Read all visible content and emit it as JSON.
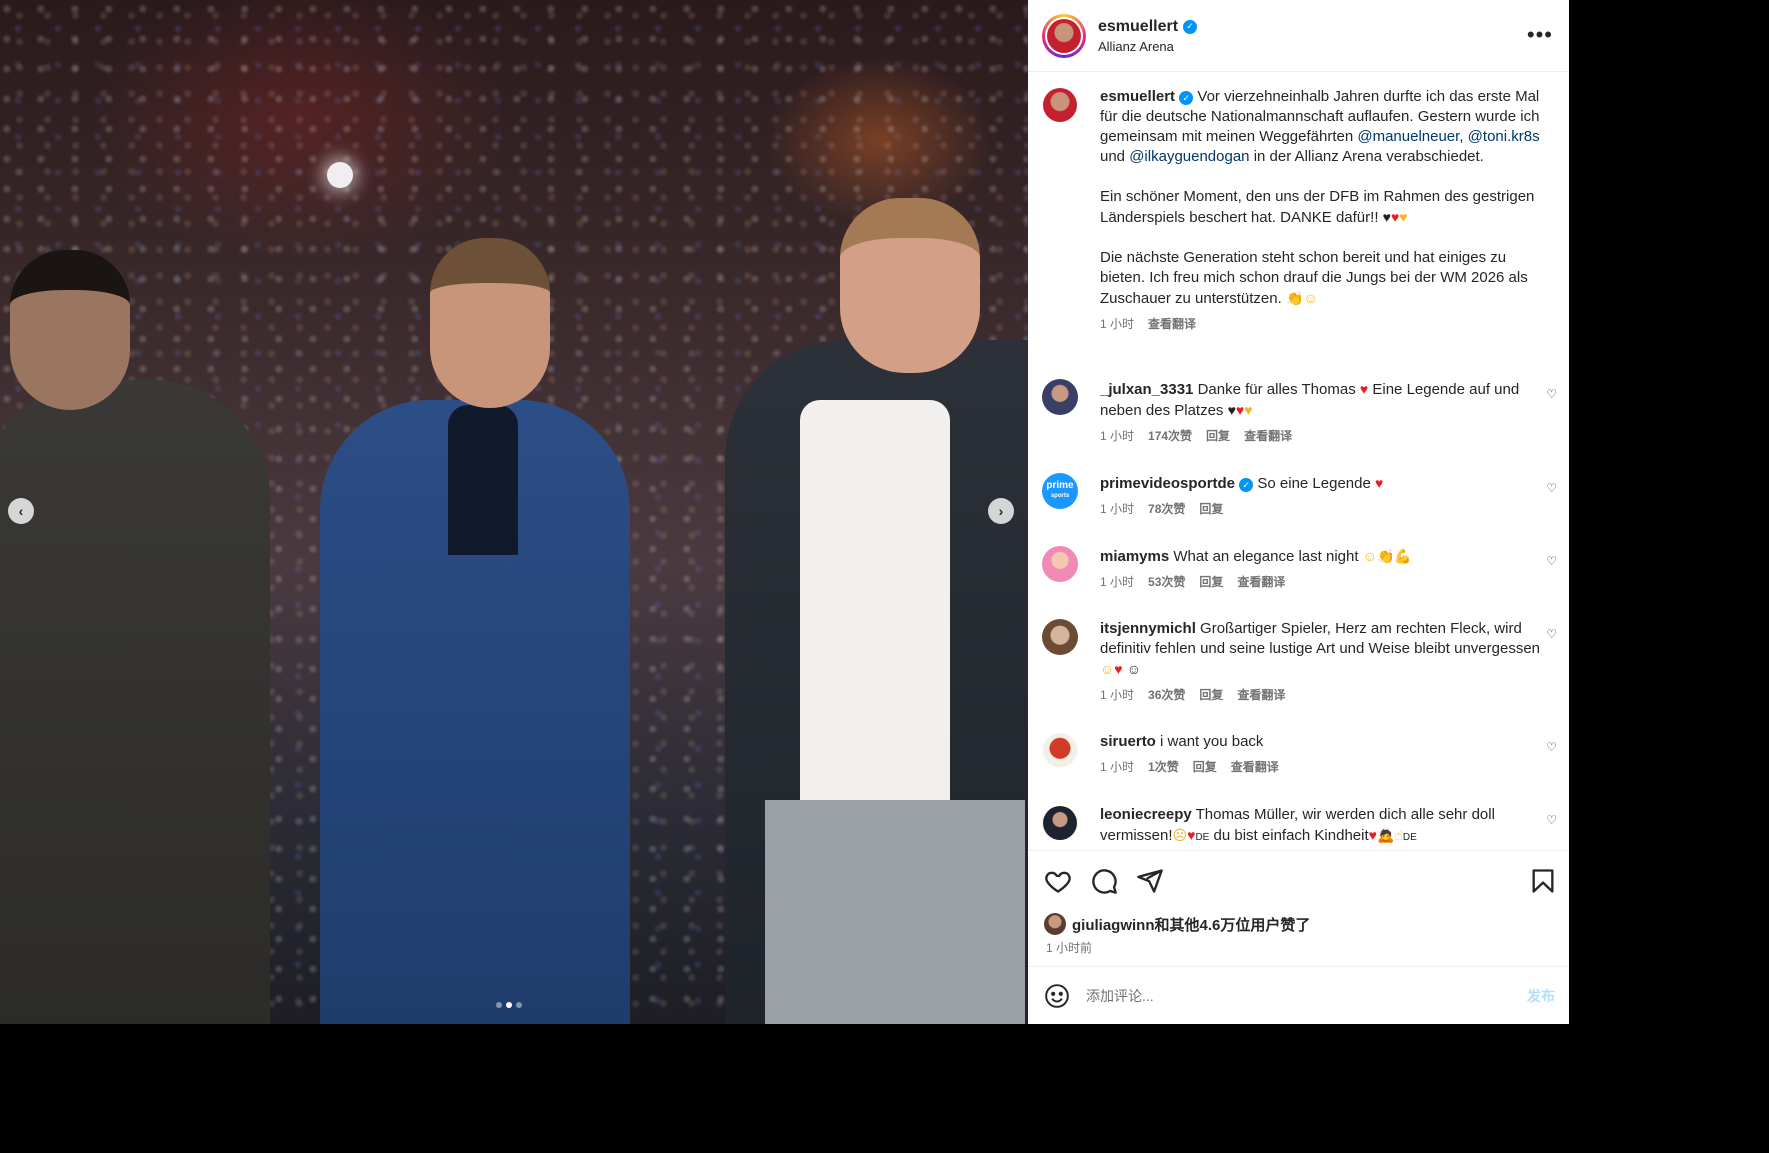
{
  "post": {
    "username": "esmuellert",
    "location": "Allianz Arena",
    "more_icon": "more-horizontal-icon"
  },
  "caption": {
    "username": "esmuellert",
    "part1": "Vor vierzehneinhalb Jahren durfte ich das erste Mal für die deutsche Nationalmannschaft auflaufen. Gestern wurde ich gemeinsam mit meinen Weggefährten ",
    "mention1": "@manuelneuer",
    "sep1": ", ",
    "mention2": "@toni.kr8s",
    "sep2": " und ",
    "mention3": "@ilkayguendogan",
    "part2": " in der Allianz Arena verabschiedet.",
    "para2": "Ein schöner Moment, den uns der DFB im Rahmen des gestrigen Länderspiels beschert hat. DANKE dafür!!",
    "para3": "Die nächste Generation steht schon bereit und hat einiges zu bieten. Ich freu mich schon drauf die Jungs bei der WM 2026 als Zuschauer zu unterstützen.",
    "time": "1 小时",
    "translate": "查看翻译"
  },
  "comments": [
    {
      "username": "_julxan_3331",
      "text": "Danke für alles Thomas",
      "text2": "Eine Legende auf und neben des Platzes",
      "time": "1 小时",
      "likes": "174次赞",
      "reply": "回复",
      "translate": "查看翻译"
    },
    {
      "username": "primevideosportde",
      "text": "So eine Legende",
      "time": "1 小时",
      "likes": "78次赞",
      "reply": "回复",
      "avatar_label": "prime",
      "avatar_sub": "sports"
    },
    {
      "username": "miamyms",
      "text": "What an elegance last night",
      "time": "1 小时",
      "likes": "53次赞",
      "reply": "回复",
      "translate": "查看翻译"
    },
    {
      "username": "itsjennymichl",
      "text": "Großartiger Spieler, Herz am rechten Fleck, wird definitiv fehlen und seine lustige Art und Weise bleibt unvergessen",
      "time": "1 小时",
      "likes": "36次赞",
      "reply": "回复",
      "translate": "查看翻译"
    },
    {
      "username": "siruerto",
      "text": "i want you back",
      "time": "1 小时",
      "likes": "1次赞",
      "reply": "回复",
      "translate": "查看翻译"
    },
    {
      "username": "leoniecreepy",
      "text": "Thomas Müller, wir werden dich alle sehr doll vermissen!",
      "text2": "du bist einfach Kindheit",
      "flag": "DE"
    }
  ],
  "actions": {
    "liked_by_user": "giuliagwinn",
    "liked_by_rest": "和其他4.6万位用户赞了",
    "time": "1 小时前"
  },
  "composer": {
    "placeholder": "添加评论...",
    "post_label": "发布"
  },
  "colors": {
    "verified": "#0095f6",
    "mention": "#00376b",
    "post_button_disabled": "#b2dffc",
    "meta_gray": "#737373"
  }
}
